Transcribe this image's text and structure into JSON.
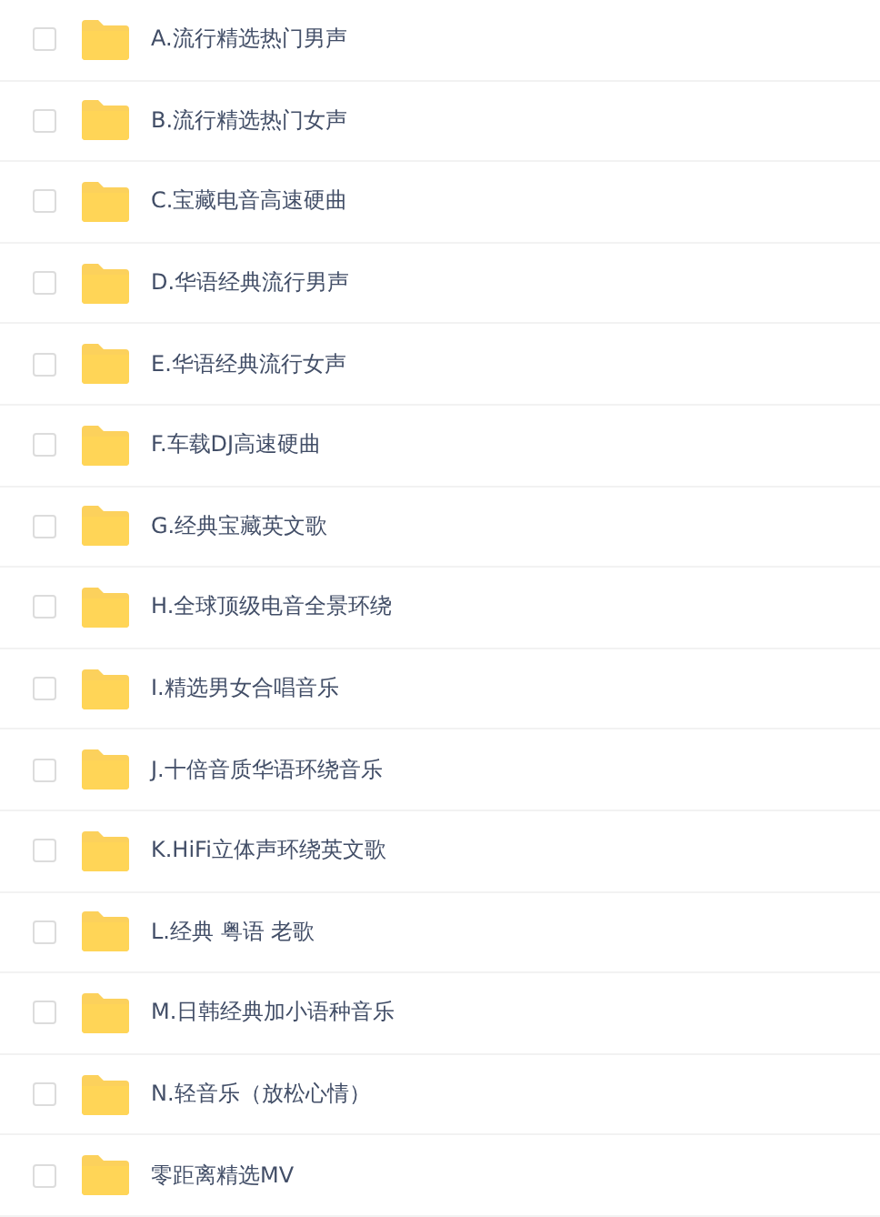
{
  "files": [
    {
      "name": "A.流行精选热门男声",
      "checked": false
    },
    {
      "name": "B.流行精选热门女声",
      "checked": false
    },
    {
      "name": "C.宝藏电音高速硬曲",
      "checked": false
    },
    {
      "name": "D.华语经典流行男声",
      "checked": false
    },
    {
      "name": "E.华语经典流行女声",
      "checked": false
    },
    {
      "name": "F.车载DJ高速硬曲",
      "checked": false
    },
    {
      "name": "G.经典宝藏英文歌",
      "checked": false
    },
    {
      "name": "H.全球顶级电音全景环绕",
      "checked": false
    },
    {
      "name": "I.精选男女合唱音乐",
      "checked": false
    },
    {
      "name": "J.十倍音质华语环绕音乐",
      "checked": false
    },
    {
      "name": "K.HiFi立体声环绕英文歌",
      "checked": false
    },
    {
      "name": "L.经典 粤语 老歌",
      "checked": false
    },
    {
      "name": "M.日韩经典加小语种音乐",
      "checked": false
    },
    {
      "name": "N.轻音乐（放松心情）",
      "checked": false
    },
    {
      "name": "零距离精选MV",
      "checked": false
    }
  ]
}
